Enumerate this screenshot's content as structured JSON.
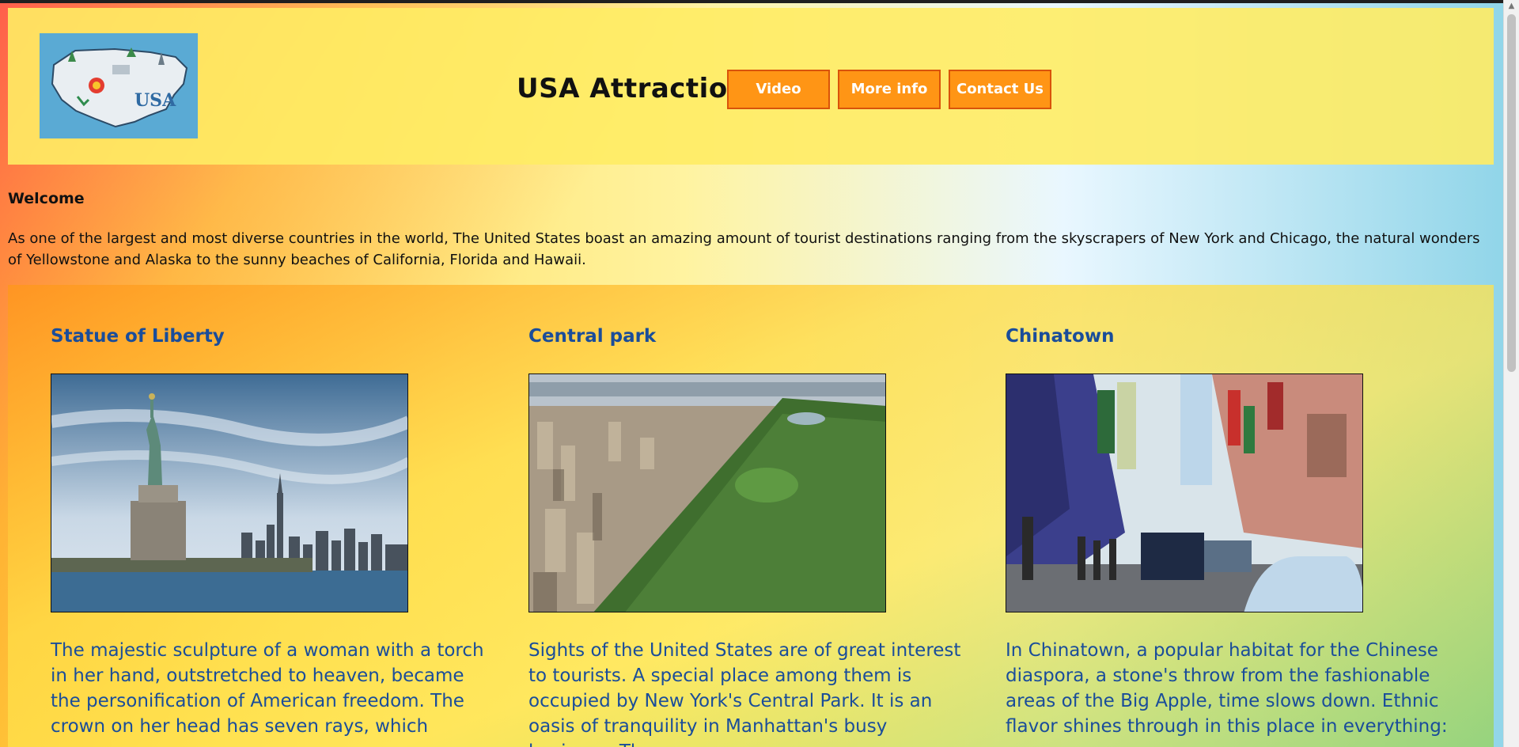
{
  "header": {
    "logo_text": "USA",
    "title": "USA Attractions",
    "nav": [
      {
        "label": "Video"
      },
      {
        "label": "More info"
      },
      {
        "label": "Contact Us"
      }
    ]
  },
  "welcome": {
    "heading": "Welcome",
    "text": "As one of the largest and most diverse countries in the world, The United States boast an amazing amount of tourist destinations ranging from the skyscrapers of New York and Chicago, the natural wonders of Yellowstone and Alaska to the sunny beaches of California, Florida and Hawaii."
  },
  "attractions": [
    {
      "title": "Statue of Liberty",
      "text": "The majestic sculpture of a woman with a torch in her hand, outstretched to heaven, became the personification of American freedom. The crown on her head has seven rays, which means seven"
    },
    {
      "title": "Central park",
      "text": "Sights of the United States are of great interest to tourists. A special place among them is occupied by New York's Central Park. It is an oasis of tranquility in Manhattan's busy business. The green"
    },
    {
      "title": "Chinatown",
      "text": "In Chinatown, a popular habitat for the Chinese diaspora, a stone's throw from the fashionable areas of the Big Apple, time slows down. Ethnic flavor shines through in this place in everything:"
    }
  ],
  "colors": {
    "header_bg": "#ffec64",
    "button_bg": "#ff9515",
    "button_border": "#d9530a",
    "card_text": "#1a4d9a"
  }
}
